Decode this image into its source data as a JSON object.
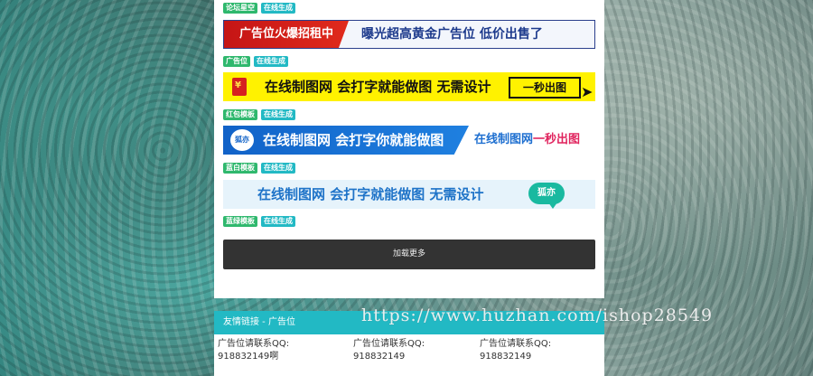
{
  "ads": [
    {
      "tags": [
        "论坛星空",
        "在线生成"
      ],
      "banner": {
        "left_text": "广告位火爆招租中",
        "right_text": "曝光超高黄金广告位 低价出售了"
      }
    },
    {
      "tags": [
        "广告位",
        "在线生成"
      ],
      "banner": {
        "main_text": "在线制图网 会打字就能做图 无需设计",
        "button_text": "一秒出图"
      }
    },
    {
      "tags": [
        "红包模板",
        "在线生成"
      ],
      "banner": {
        "logo_text": "狐亦",
        "main_text": "在线制图网 会打字你就能做图",
        "right_text_a": "在线制图网",
        "right_text_b": "一秒出图"
      }
    },
    {
      "tags": [
        "蓝白模板",
        "在线生成"
      ],
      "banner": {
        "main_text": "在线制图网 会打字就能做图 无需设计",
        "bubble_text": "狐亦"
      }
    }
  ],
  "last_tags": [
    "蓝绿模板",
    "在线生成"
  ],
  "load_more": "加载更多",
  "friend_links": {
    "title": "友情链接 - 广告位",
    "columns": [
      {
        "line1": "广告位请联系QQ:",
        "line2": "918832149啊"
      },
      {
        "line1": "广告位请联系QQ:",
        "line2": "918832149"
      },
      {
        "line1": "广告位请联系QQ:",
        "line2": "918832149"
      }
    ]
  },
  "watermark": "https://www.huzhan.com/ishop28549"
}
